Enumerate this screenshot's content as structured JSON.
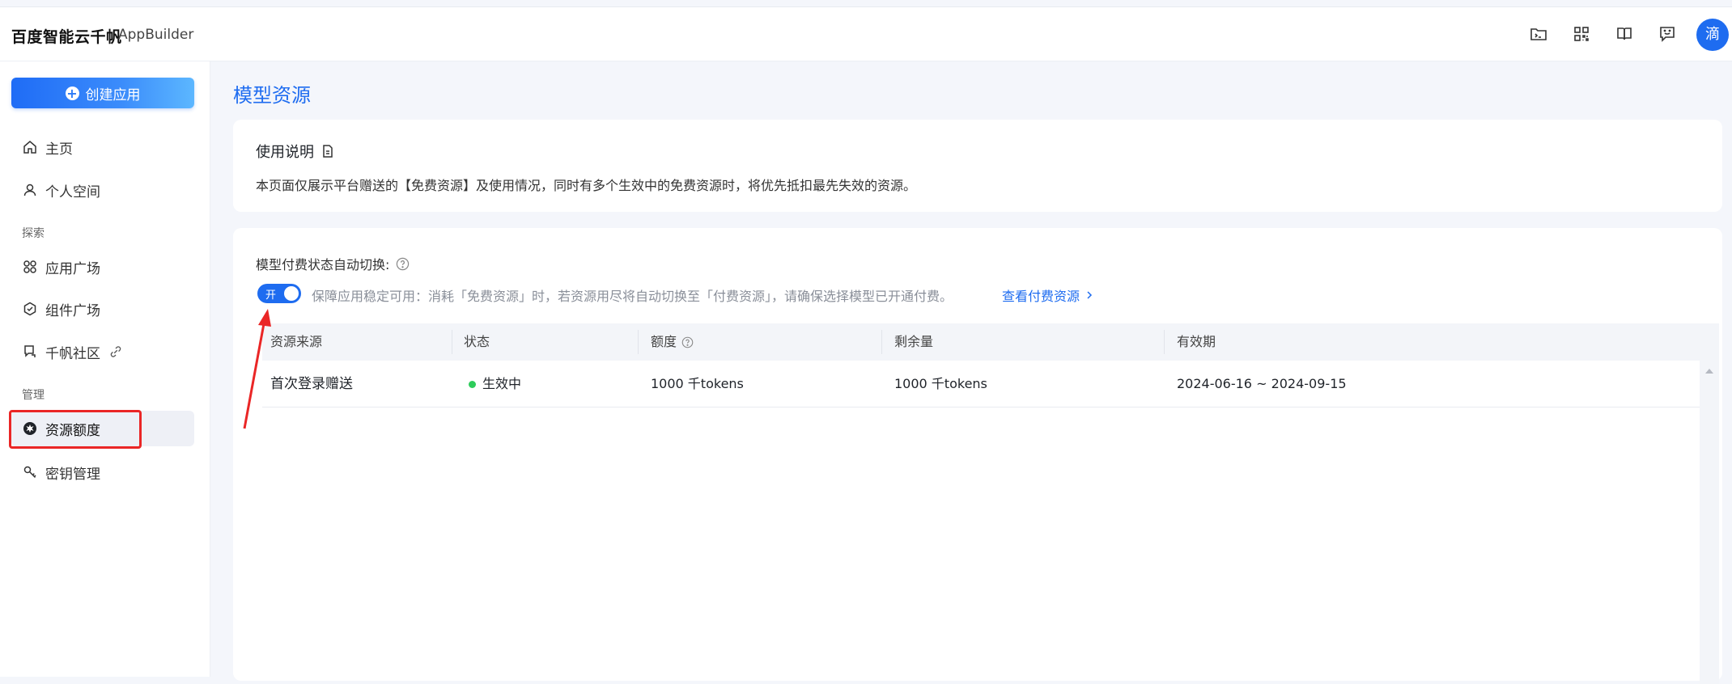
{
  "brand": {
    "name": "百度智能云千帆",
    "product": "AppBuilder"
  },
  "header": {
    "avatar_text": "滴"
  },
  "sidebar": {
    "create_label": "创建应用",
    "items": [
      {
        "label": "主页",
        "icon": "home-icon"
      },
      {
        "label": "个人空间",
        "icon": "user-icon"
      },
      {
        "label": "应用广场",
        "icon": "app-grid-icon"
      },
      {
        "label": "组件广场",
        "icon": "component-icon"
      },
      {
        "label": "千帆社区",
        "icon": "community-icon"
      },
      {
        "label": "资源额度",
        "icon": "resource-icon",
        "active": true
      },
      {
        "label": "密钥管理",
        "icon": "key-icon"
      }
    ],
    "sections": {
      "explore": "探索",
      "manage": "管理"
    }
  },
  "main": {
    "title": "模型资源",
    "usage": {
      "title": "使用说明",
      "desc": "本页面仅展示平台赠送的【免费资源】及使用情况，同时有多个生效中的免费资源时，将优先抵扣最先失效的资源。"
    },
    "switch": {
      "label": "模型付费状态自动切换:",
      "toggle_text": "开",
      "on": true,
      "desc": "保障应用稳定可用：消耗「免费资源」时，若资源用尽将自动切换至「付费资源」，请确保选择模型已开通付费。",
      "link": "查看付费资源"
    },
    "table": {
      "headers": [
        "资源来源",
        "状态",
        "额度",
        "剩余量",
        "有效期"
      ],
      "rows": [
        {
          "source": "首次登录赠送",
          "status": "生效中",
          "quota": "1000 千tokens",
          "remaining": "1000 千tokens",
          "validity": "2024-06-16 ~ 2024-09-15"
        }
      ]
    }
  },
  "colors": {
    "accent": "#1e6cf0",
    "active_status": "#2ecc5b",
    "annotation": "#ea2626"
  }
}
